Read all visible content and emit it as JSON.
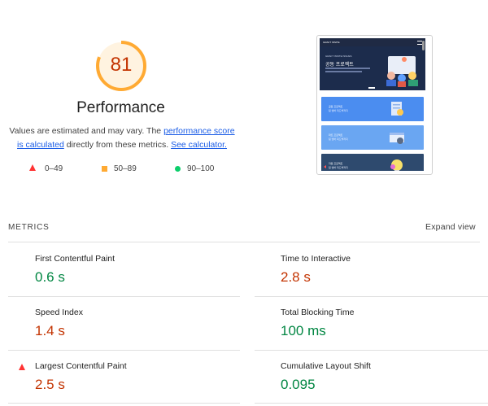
{
  "summary": {
    "score": "81",
    "score_fraction": 0.81,
    "category_title": "Performance",
    "desc_part1": "Values are estimated and may vary. The ",
    "desc_link1": "performance score is calculated",
    "desc_part2": " directly from these metrics. ",
    "desc_link2": "See calculator.",
    "legend": {
      "fail": "0–49",
      "average": "50–89",
      "pass": "90–100"
    }
  },
  "screenshot": {
    "header_logo": "GRAFT INSITE",
    "hero_small": "GRAFT INSITE ISSUES",
    "hero_title": "공동 프로젝트",
    "card1_title": "공동 프로젝트",
    "card1_sub": "팀 멤버 피드백까지",
    "card2_title": "파트 프로젝트",
    "card2_sub": "팀 멤버 피드백까지",
    "card3_title": "자동 프로젝트",
    "card3_sub": "팀 멤버 피드백까지"
  },
  "metrics": {
    "section_label": "METRICS",
    "expand_label": "Expand view",
    "items": [
      {
        "name": "First Contentful Paint",
        "value": "0.6 s",
        "status": "pass"
      },
      {
        "name": "Time to Interactive",
        "value": "2.8 s",
        "status": "average"
      },
      {
        "name": "Speed Index",
        "value": "1.4 s",
        "status": "average"
      },
      {
        "name": "Total Blocking Time",
        "value": "100 ms",
        "status": "pass"
      },
      {
        "name": "Largest Contentful Paint",
        "value": "2.5 s",
        "status": "fail"
      },
      {
        "name": "Cumulative Layout Shift",
        "value": "0.095",
        "status": "pass"
      }
    ]
  },
  "colors": {
    "fail": "#ff3333",
    "average": "#ffaa33",
    "average_text": "#c33300",
    "pass": "#0cce6b",
    "pass_text": "#018642",
    "link": "#1a5ce6"
  }
}
